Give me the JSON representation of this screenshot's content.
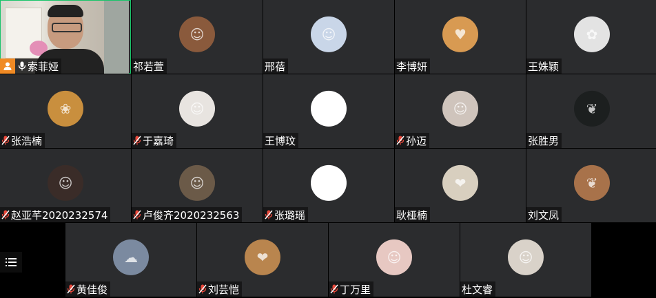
{
  "participants_row1": [
    {
      "name": "索菲娅",
      "host": true,
      "muted": false,
      "has_video": true
    },
    {
      "name": "祁若萱",
      "muted": false,
      "avatar_color": "#8a5a3c",
      "avatar_glyph": "☺"
    },
    {
      "name": "邢蓓",
      "muted": false,
      "avatar_color": "#c9d6e8",
      "avatar_glyph": "☺"
    },
    {
      "name": "李博妍",
      "muted": false,
      "avatar_color": "#d89a52",
      "avatar_glyph": "♥"
    },
    {
      "name": "王姝颖",
      "muted": false,
      "avatar_color": "#e3e3e3",
      "avatar_glyph": "✿"
    }
  ],
  "participants_row2": [
    {
      "name": "张浩楠",
      "muted": true,
      "avatar_color": "#c98f3e",
      "avatar_glyph": "❀"
    },
    {
      "name": "于嘉琦",
      "muted": true,
      "avatar_color": "#e8e4e0",
      "avatar_glyph": "☺"
    },
    {
      "name": "王博玟",
      "muted": false,
      "avatar_color": "#ffffff",
      "avatar_glyph": "✎"
    },
    {
      "name": "孙迈",
      "muted": true,
      "avatar_color": "#cfc4bc",
      "avatar_glyph": "☺"
    },
    {
      "name": "张胜男",
      "muted": false,
      "avatar_color": "#1c1f1f",
      "avatar_glyph": "❦"
    }
  ],
  "participants_row3": [
    {
      "name": "赵亚芊2020232574",
      "muted": true,
      "avatar_color": "#3a2c28",
      "avatar_glyph": "☺"
    },
    {
      "name": "卢俊齐2020232563",
      "muted": true,
      "avatar_color": "#6b5a48",
      "avatar_glyph": "☺"
    },
    {
      "name": "张璐瑶",
      "muted": true,
      "avatar_color": "#ffffff",
      "avatar_glyph": "ᓚ"
    },
    {
      "name": "耿桠楠",
      "muted": false,
      "avatar_color": "#d8cfbf",
      "avatar_glyph": "❤"
    },
    {
      "name": "刘文凤",
      "muted": false,
      "avatar_color": "#a8724a",
      "avatar_glyph": "❦"
    }
  ],
  "participants_row4": [
    {
      "name": "黄佳俊",
      "muted": true,
      "avatar_color": "#7b8aa0",
      "avatar_glyph": "☁"
    },
    {
      "name": "刘芸恺",
      "muted": true,
      "avatar_color": "#b9854e",
      "avatar_glyph": "❤"
    },
    {
      "name": "丁万里",
      "muted": true,
      "avatar_color": "#e7c8c2",
      "avatar_glyph": "☺"
    },
    {
      "name": "杜文睿",
      "muted": false,
      "avatar_color": "#d9d2c9",
      "avatar_glyph": "☺"
    }
  ],
  "colors": {
    "tile_bg": "#2b2c2e",
    "speaking_border": "#19c46a",
    "host_badge": "#f08a24",
    "muted_mic": "#e8483b"
  },
  "menu_icon": "list-icon"
}
